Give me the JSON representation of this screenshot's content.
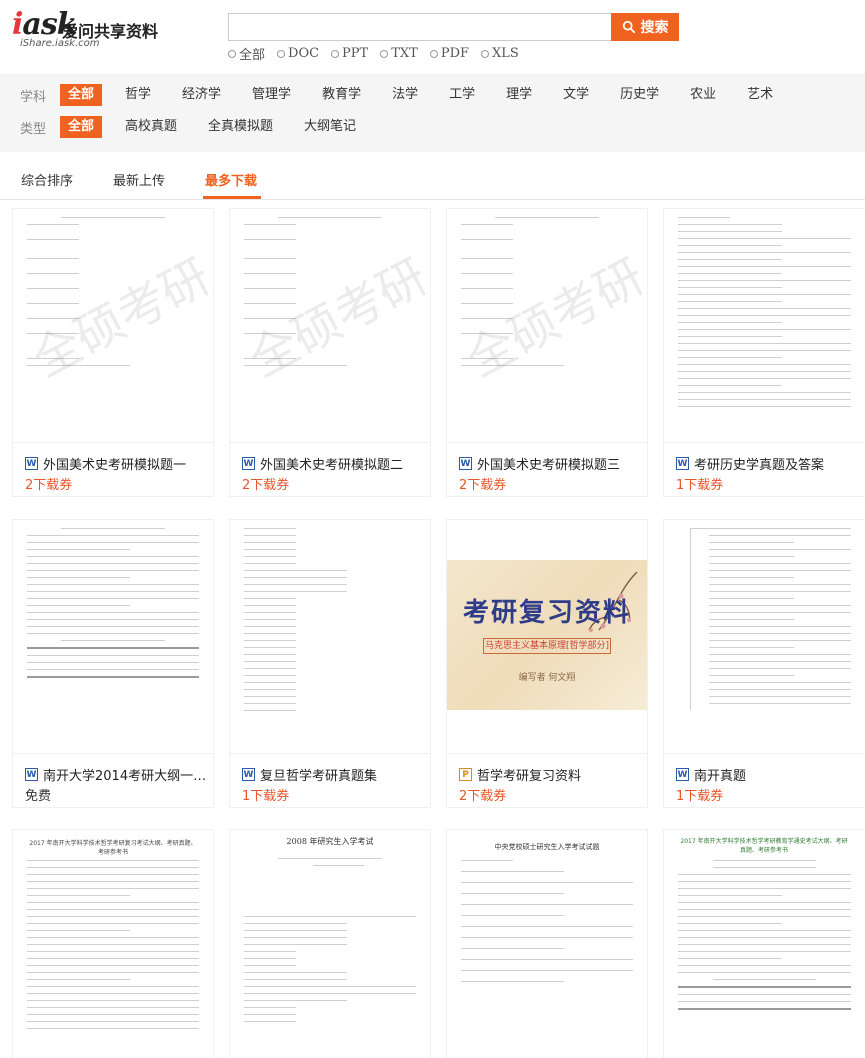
{
  "header": {
    "logo_mark_main": "iask",
    "logo_cn": "爱问共享资料",
    "logo_url": "iShare.iask.com",
    "search_value": "",
    "search_button": "搜索",
    "filetypes": [
      "全部",
      "DOC",
      "PPT",
      "TXT",
      "PDF",
      "XLS"
    ]
  },
  "filters": {
    "subject_label": "学科",
    "subjects": [
      "全部",
      "哲学",
      "经济学",
      "管理学",
      "教育学",
      "法学",
      "工学",
      "理学",
      "文学",
      "历史学",
      "农业",
      "艺术"
    ],
    "type_label": "类型",
    "types": [
      "全部",
      "高校真题",
      "全真模拟题",
      "大纲笔记"
    ]
  },
  "sort": {
    "tabs": [
      "综合排序",
      "最新上传",
      "最多下载"
    ],
    "active": "最多下载"
  },
  "cards": [
    {
      "title": "外国美术史考研模拟题一",
      "price": "2下载券",
      "type": "W"
    },
    {
      "title": "外国美术史考研模拟题二",
      "price": "2下载券",
      "type": "W"
    },
    {
      "title": "外国美术史考研模拟题三",
      "price": "2下载券",
      "type": "W"
    },
    {
      "title": "考研历史学真题及答案",
      "price": "1下载券",
      "type": "W"
    },
    {
      "title": "南开大学2014考研大纲一…",
      "price": "免费",
      "type": "W"
    },
    {
      "title": "复旦哲学考研真题集",
      "price": "1下载券",
      "type": "W"
    },
    {
      "title": "哲学考研复习资料",
      "price": "2下载券",
      "type": "P"
    },
    {
      "title": "南开真题",
      "price": "1下载券",
      "type": "W"
    }
  ],
  "thumb_text": {
    "watermark": "全硕考研",
    "cover_title": "考研复习资料",
    "cover_subtitle": "马克思主义基本原理[哲学部分]",
    "cover_author": "编写者  何文翔",
    "row3_doc2_heading": "2008 年研究生入学考试",
    "row3_doc3_heading": "中央党校硕士研究生入学考试试题",
    "row3_doc4_heading": "2017 年南开大学科学技术哲学考研教育学通史考试大纲、考研真题、考研参考书",
    "row3_doc1_heading": "2017 年南开大学科学技术哲学考研复习考试大纲、考研真题、考研参考书"
  },
  "colors": {
    "accent": "#f0621f",
    "price": "#e8552a",
    "doc_badge": "#2b5aa8",
    "ppt_badge": "#e08a1e"
  }
}
